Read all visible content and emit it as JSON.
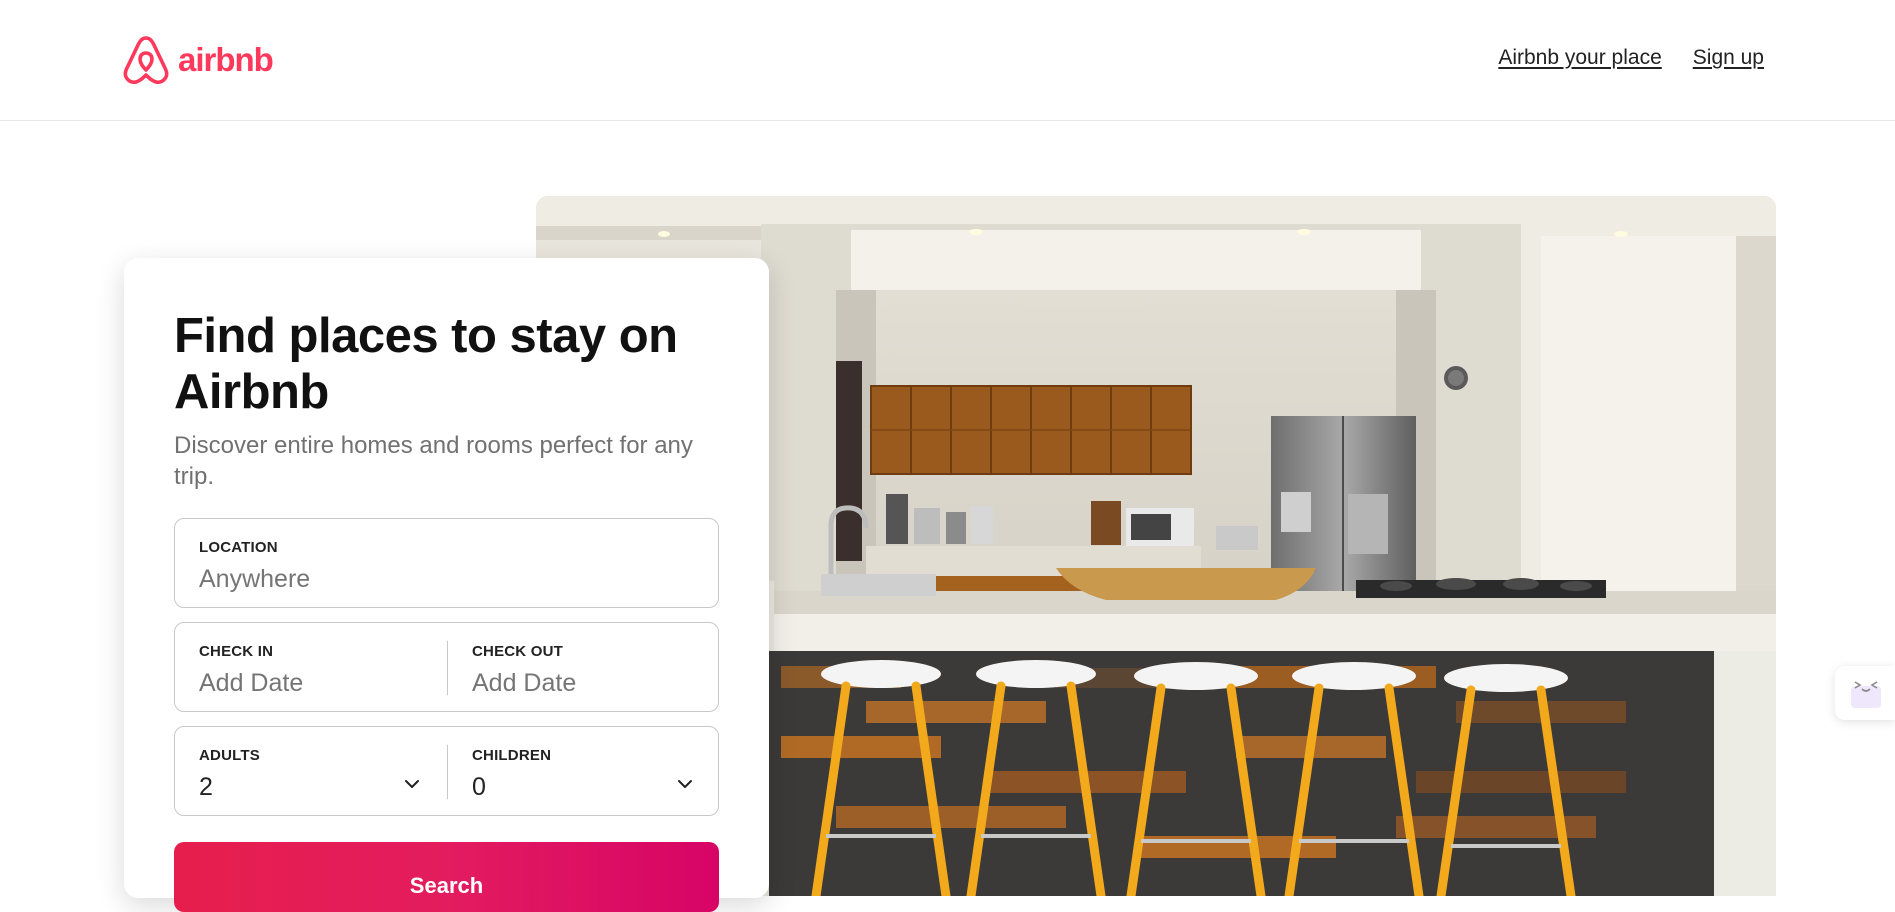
{
  "brand": {
    "name": "airbnb",
    "color": "#ff385c"
  },
  "nav": {
    "host_link": "Airbnb your place",
    "signup_link": "Sign up"
  },
  "search_card": {
    "title": "Find places to stay on Airbnb",
    "subtitle": "Discover entire homes and rooms perfect for any trip.",
    "location": {
      "label": "LOCATION",
      "placeholder": "Anywhere"
    },
    "check_in": {
      "label": "CHECK IN",
      "placeholder": "Add Date"
    },
    "check_out": {
      "label": "CHECK OUT",
      "placeholder": "Add Date"
    },
    "adults": {
      "label": "ADULTS",
      "value": "2"
    },
    "children": {
      "label": "CHILDREN",
      "value": "0"
    },
    "search_button": "Search",
    "button_color": "#e31c5f"
  },
  "icons": {
    "logo": "airbnb-belo-icon",
    "select_arrow": "chevron-down-icon",
    "side_widget": "extension-widget-icon"
  }
}
